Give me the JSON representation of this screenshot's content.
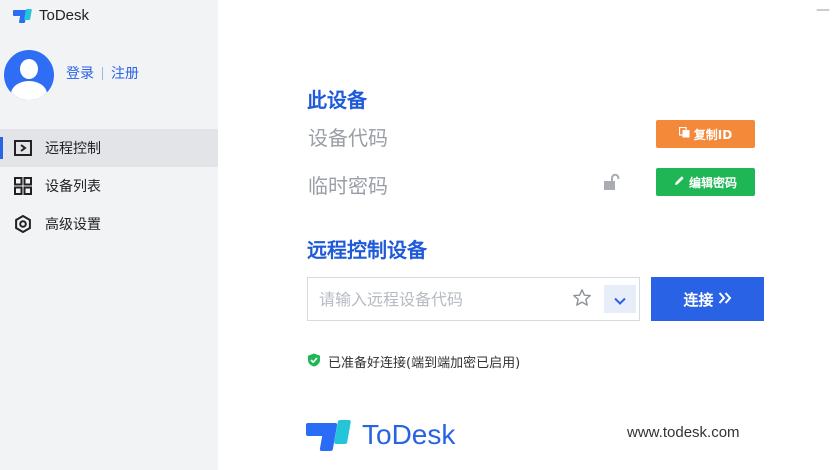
{
  "app": {
    "name": "ToDesk",
    "minimize": "—"
  },
  "user": {
    "login": "登录",
    "register": "注册"
  },
  "sidebar": {
    "items": [
      {
        "label": "远程控制",
        "icon": "remote-control-icon",
        "active": true
      },
      {
        "label": "设备列表",
        "icon": "grid-icon",
        "active": false
      },
      {
        "label": "高级设置",
        "icon": "gear-icon",
        "active": false
      }
    ]
  },
  "this_device": {
    "title": "此设备",
    "device_code_label": "设备代码",
    "temp_password_label": "临时密码",
    "copy_button": "复制ID",
    "edit_button": "编辑密码"
  },
  "remote": {
    "title": "远程控制设备",
    "placeholder": "请输入远程设备代码",
    "input_value": "",
    "connect_button": "连接"
  },
  "status": {
    "text": "已准备好连接(端到端加密已启用)",
    "color": "#1fb655"
  },
  "footer": {
    "brand": "ToDesk",
    "url": "www.todesk.com"
  },
  "colors": {
    "accent": "#2a62e6",
    "copy": "#f5893a",
    "edit": "#1fb655",
    "sidebar": "#f2f3f5"
  }
}
